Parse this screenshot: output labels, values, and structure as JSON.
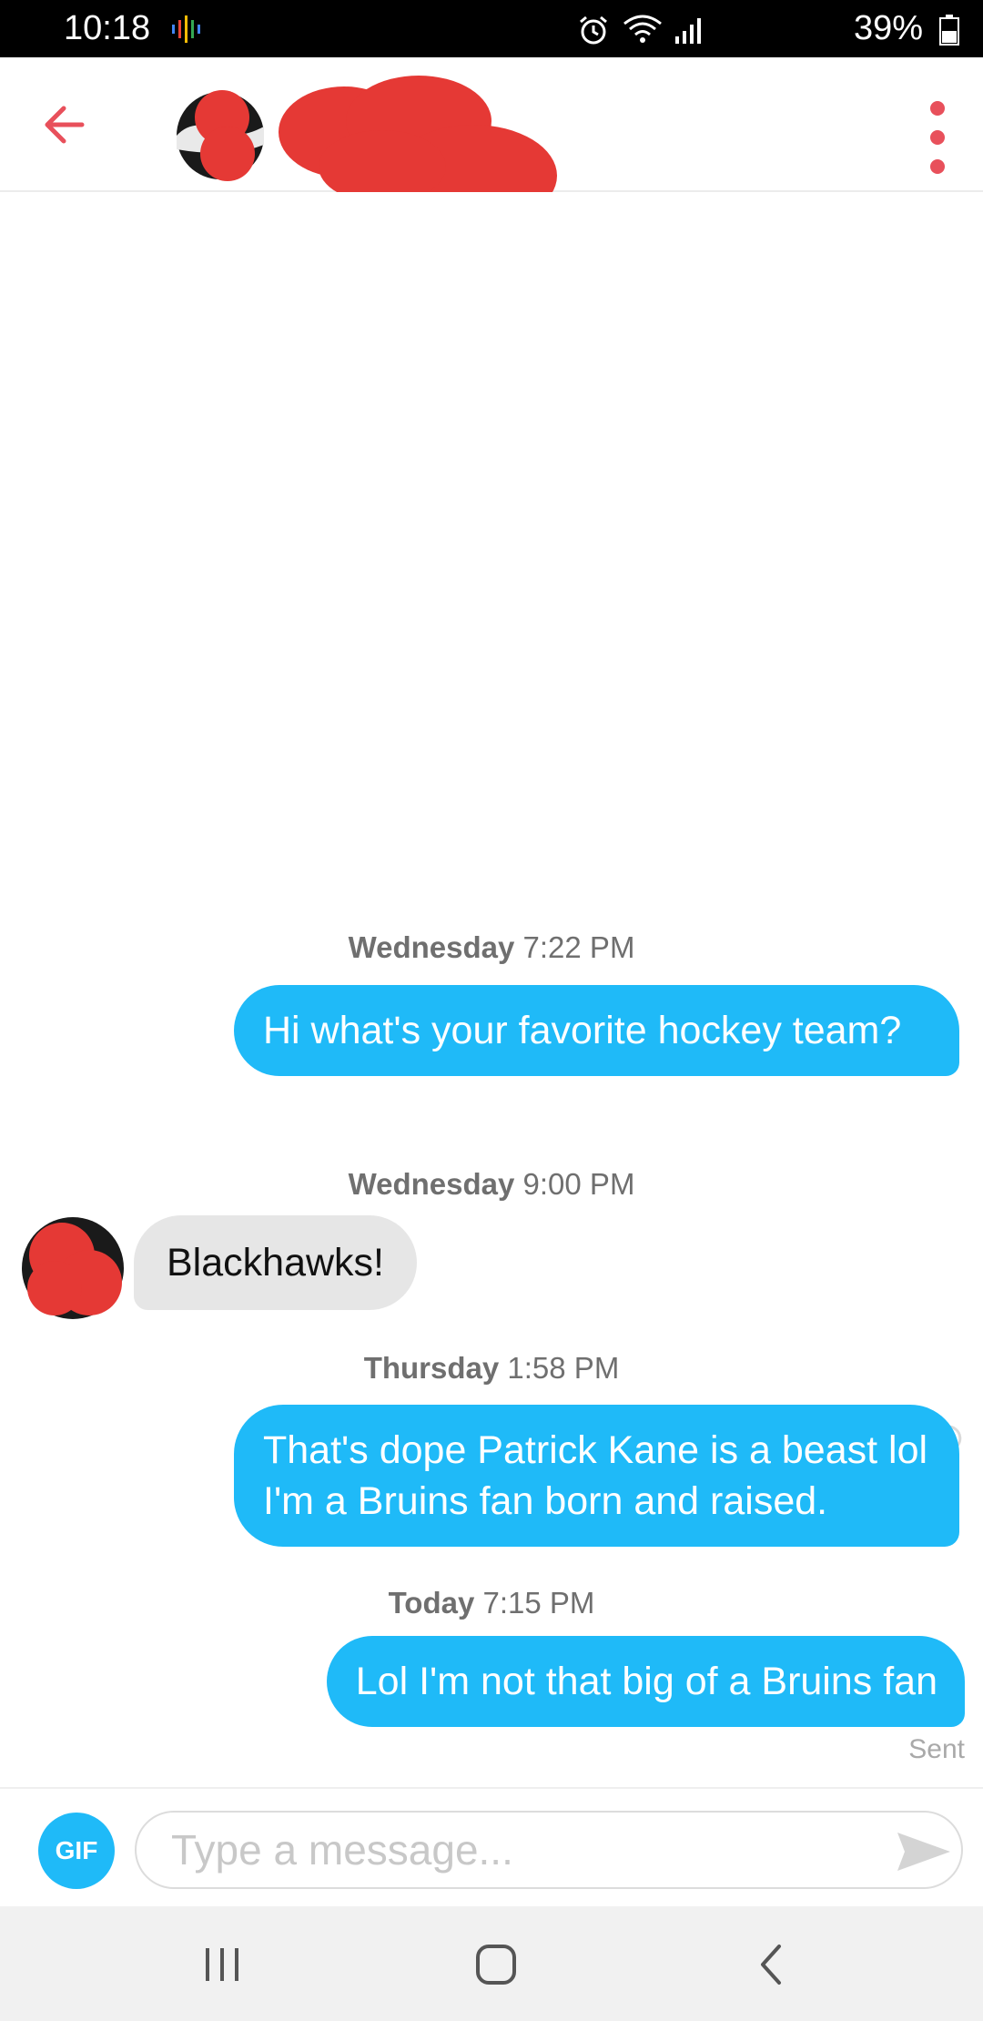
{
  "status_bar": {
    "time": "10:18",
    "battery_percent": "39%",
    "icons": [
      "alarm-icon",
      "wifi-icon",
      "cell-signal-icon",
      "battery-icon"
    ]
  },
  "header": {
    "back_icon": "arrow-left-icon",
    "menu_icon": "more-vertical-icon",
    "accent_color": "#e8505b"
  },
  "messages": [
    {
      "timestamp_day": "Wednesday",
      "timestamp_time": "7:22 PM",
      "direction": "outgoing",
      "text": "Hi what's your favorite hockey team?"
    },
    {
      "timestamp_day": "Wednesday",
      "timestamp_time": "9:00 PM",
      "direction": "incoming",
      "text": "Blackhawks!"
    },
    {
      "timestamp_day": "Thursday",
      "timestamp_time": "1:58 PM",
      "direction": "outgoing",
      "text": "That's dope Patrick Kane is a beast lol I'm a Bruins fan born and raised."
    },
    {
      "timestamp_day": "Today",
      "timestamp_time": "7:15 PM",
      "direction": "outgoing",
      "text": "Lol I'm not that big of a Bruins fan",
      "status": "Sent"
    }
  ],
  "composer": {
    "gif_label": "GIF",
    "placeholder": "Type a message...",
    "send_icon": "send-icon",
    "accent_color": "#1fbaf8"
  },
  "navbar": {
    "icons": [
      "recent-apps-icon",
      "home-icon",
      "back-icon"
    ]
  }
}
